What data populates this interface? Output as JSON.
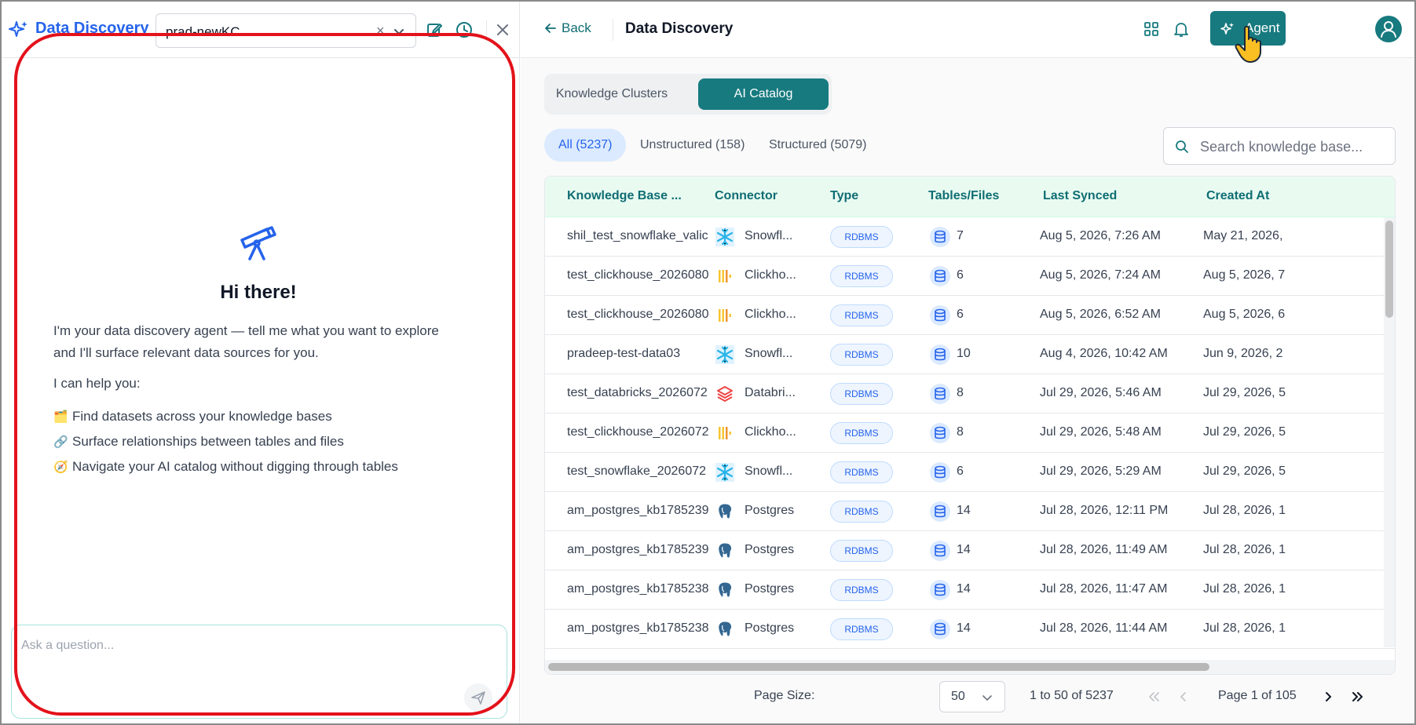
{
  "left_panel": {
    "brand_title": "Data Discovery",
    "kc_select": {
      "value": "prad-newKC",
      "clear_glyph": "×"
    },
    "hero_title": "Hi there!",
    "intro": "I'm your data discovery agent — tell me what you want to explore and I'll surface relevant data sources for you.",
    "help_label": "I can help you:",
    "help_items": [
      {
        "emoji": "🗂️",
        "text": "Find datasets across your knowledge bases"
      },
      {
        "emoji": "🔗",
        "text": "Surface relationships between tables and files"
      },
      {
        "emoji": "🧭",
        "text": "Navigate your AI catalog without digging through tables"
      }
    ],
    "ask_placeholder": "Ask a question..."
  },
  "top_bar": {
    "back_label": "Back",
    "page_title": "Data Discovery",
    "agent_label": "Agent"
  },
  "tabs": [
    {
      "label": "Knowledge Clusters",
      "active": false
    },
    {
      "label": "AI Catalog",
      "active": true
    }
  ],
  "filters": [
    {
      "label": "All (5237)",
      "active": true
    },
    {
      "label": "Unstructured (158)",
      "active": false
    },
    {
      "label": "Structured (5079)",
      "active": false
    }
  ],
  "search_placeholder": "Search knowledge base...",
  "table": {
    "columns": [
      "Knowledge Base ...",
      "Connector",
      "Type",
      "Tables/Files",
      "Last Synced",
      "Created At"
    ],
    "rows": [
      {
        "name": "shil_test_snowflake_valic",
        "connector": "Snowfl...",
        "connector_type": "snowflake",
        "type": "RDBMS",
        "count": "7",
        "last_synced": "Aug 5, 2026, 7:26 AM",
        "created_at": "May 21, 2026,"
      },
      {
        "name": "test_clickhouse_2026080",
        "connector": "Clickho...",
        "connector_type": "clickhouse",
        "type": "RDBMS",
        "count": "6",
        "last_synced": "Aug 5, 2026, 7:24 AM",
        "created_at": "Aug 5, 2026, 7"
      },
      {
        "name": "test_clickhouse_2026080",
        "connector": "Clickho...",
        "connector_type": "clickhouse",
        "type": "RDBMS",
        "count": "6",
        "last_synced": "Aug 5, 2026, 6:52 AM",
        "created_at": "Aug 5, 2026, 6"
      },
      {
        "name": "pradeep-test-data03",
        "connector": "Snowfl...",
        "connector_type": "snowflake",
        "type": "RDBMS",
        "count": "10",
        "last_synced": "Aug 4, 2026, 10:42 AM",
        "created_at": "Jun 9, 2026, 2"
      },
      {
        "name": "test_databricks_2026072",
        "connector": "Databri...",
        "connector_type": "databricks",
        "type": "RDBMS",
        "count": "8",
        "last_synced": "Jul 29, 2026, 5:46 AM",
        "created_at": "Jul 29, 2026, 5"
      },
      {
        "name": "test_clickhouse_2026072",
        "connector": "Clickho...",
        "connector_type": "clickhouse",
        "type": "RDBMS",
        "count": "8",
        "last_synced": "Jul 29, 2026, 5:48 AM",
        "created_at": "Jul 29, 2026, 5"
      },
      {
        "name": "test_snowflake_2026072",
        "connector": "Snowfl...",
        "connector_type": "snowflake",
        "type": "RDBMS",
        "count": "6",
        "last_synced": "Jul 29, 2026, 5:29 AM",
        "created_at": "Jul 29, 2026, 5"
      },
      {
        "name": "am_postgres_kb1785239",
        "connector": "Postgres",
        "connector_type": "postgres",
        "type": "RDBMS",
        "count": "14",
        "last_synced": "Jul 28, 2026, 12:11 PM",
        "created_at": "Jul 28, 2026, 1"
      },
      {
        "name": "am_postgres_kb1785239",
        "connector": "Postgres",
        "connector_type": "postgres",
        "type": "RDBMS",
        "count": "14",
        "last_synced": "Jul 28, 2026, 11:49 AM",
        "created_at": "Jul 28, 2026, 1"
      },
      {
        "name": "am_postgres_kb1785238",
        "connector": "Postgres",
        "connector_type": "postgres",
        "type": "RDBMS",
        "count": "14",
        "last_synced": "Jul 28, 2026, 11:47 AM",
        "created_at": "Jul 28, 2026, 1"
      },
      {
        "name": "am_postgres_kb1785238",
        "connector": "Postgres",
        "connector_type": "postgres",
        "type": "RDBMS",
        "count": "14",
        "last_synced": "Jul 28, 2026, 11:44 AM",
        "created_at": "Jul 28, 2026, 1"
      }
    ]
  },
  "pagination": {
    "page_size_label": "Page Size:",
    "page_size_value": "50",
    "range_text": "1 to 50 of 5237",
    "page_text": "Page 1 of 105"
  },
  "colors": {
    "accent": "#177a7f",
    "brand_blue": "#2563eb",
    "highlight_ring": "#e3121b",
    "header_bg": "#e9fbf1"
  }
}
